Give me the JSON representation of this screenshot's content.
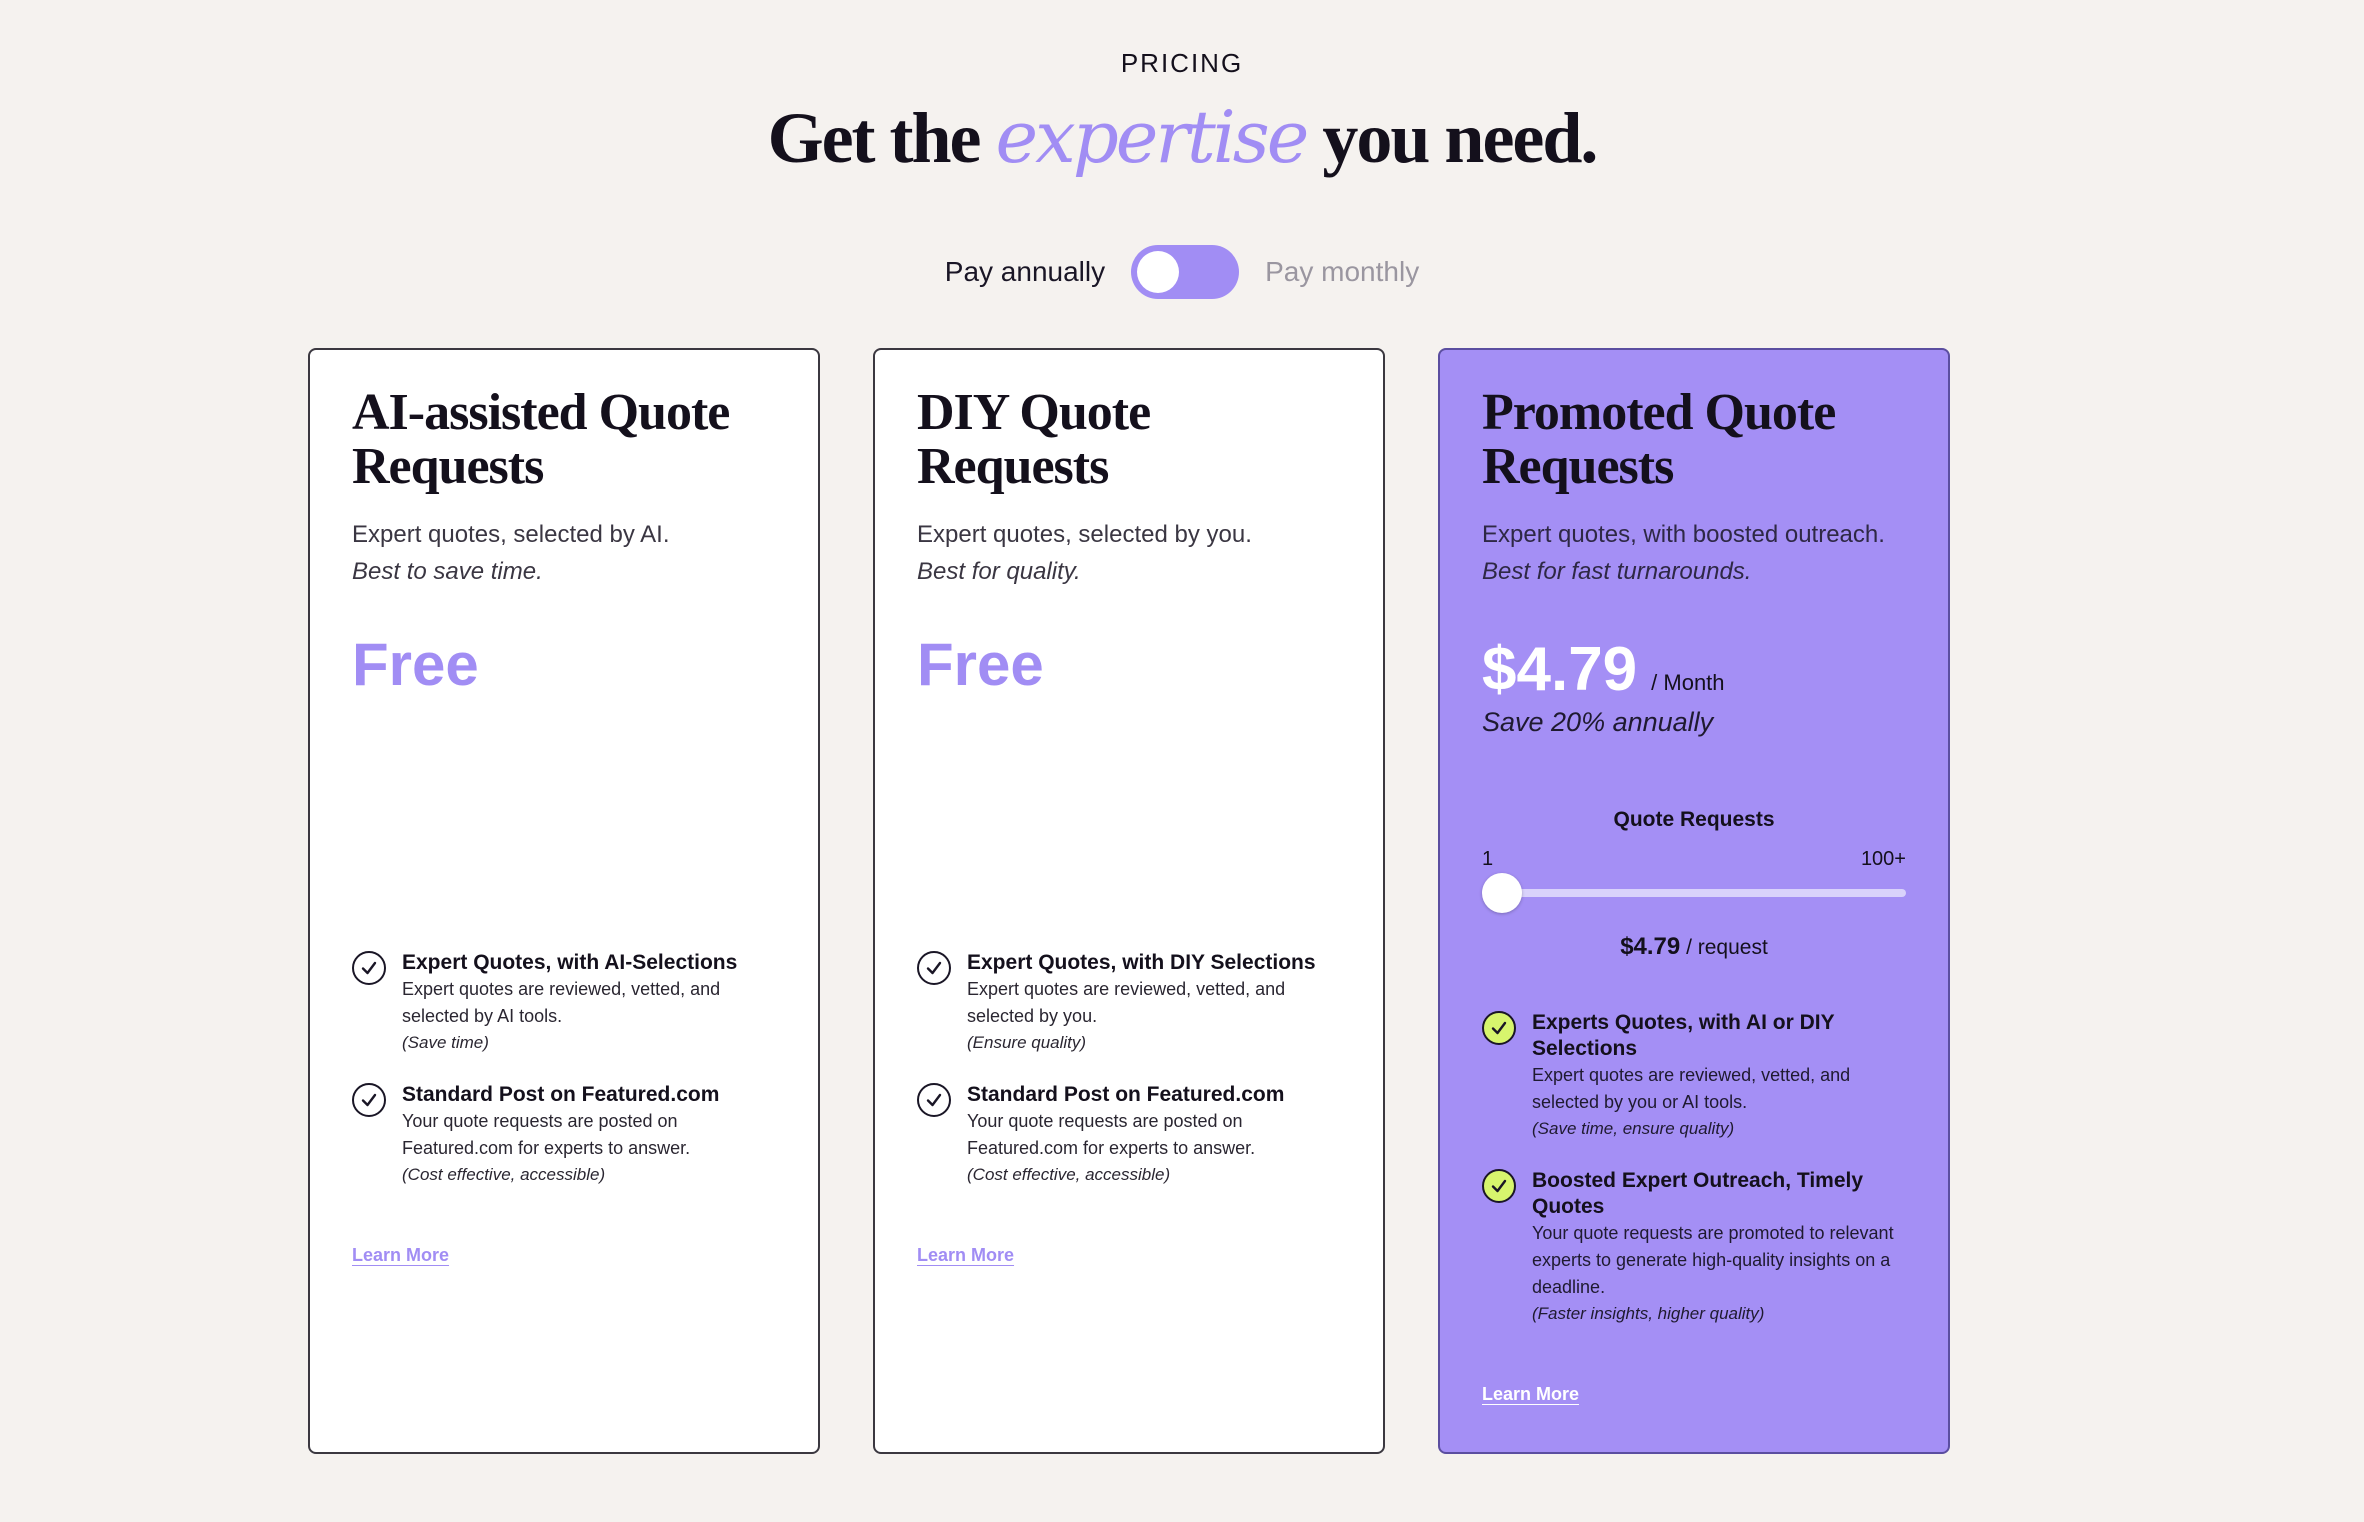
{
  "header": {
    "eyebrow": "PRICING",
    "headline_pre": "Get the",
    "headline_accent": "expertise",
    "headline_post": "you need."
  },
  "billing": {
    "annual_label": "Pay annually",
    "monthly_label": "Pay monthly",
    "selected": "annually"
  },
  "colors": {
    "accent": "#a18df4",
    "promo_card": "#a48ff5",
    "check_lime": "#d7f56d",
    "background": "#f5f2ef"
  },
  "cards": [
    {
      "title": "AI-assisted Quote Requests",
      "subtitle": "Expert quotes, selected by AI.",
      "tagline": "Best to save time.",
      "price": "Free",
      "features": [
        {
          "title": "Expert Quotes, with AI-Selections",
          "desc": "Expert quotes are reviewed, vetted, and selected by AI tools.",
          "note": "(Save time)"
        },
        {
          "title": "Standard Post on Featured.com",
          "desc": "Your quote requests are posted on Featured.com for experts to answer.",
          "note": "(Cost effective, accessible)"
        }
      ],
      "link": "Learn More"
    },
    {
      "title": "DIY Quote Requests",
      "subtitle": "Expert quotes, selected by you.",
      "tagline": "Best for quality.",
      "price": "Free",
      "features": [
        {
          "title": "Expert Quotes, with DIY Selections",
          "desc": "Expert quotes are reviewed, vetted, and selected by you.",
          "note": "(Ensure quality)"
        },
        {
          "title": "Standard Post on Featured.com",
          "desc": "Your quote requests are posted on Featured.com for experts to answer.",
          "note": "(Cost effective, accessible)"
        }
      ],
      "link": "Learn More"
    },
    {
      "title": "Promoted Quote Requests",
      "subtitle": "Expert quotes, with boosted outreach.",
      "tagline": "Best for fast turnarounds.",
      "price": "$4.79",
      "price_unit": "/ Month",
      "save_note": "Save 20% annually",
      "slider": {
        "title": "Quote Requests",
        "min_label": "1",
        "max_label": "100+",
        "value_fraction": 0,
        "per_price": "$4.79",
        "per_unit": "/ request"
      },
      "features": [
        {
          "title": "Experts Quotes, with AI or DIY Selections",
          "desc": "Expert quotes are reviewed, vetted, and selected by you or AI tools.",
          "note": "(Save time, ensure quality)"
        },
        {
          "title": "Boosted Expert Outreach, Timely Quotes",
          "desc": "Your quote requests are promoted to relevant experts to generate high-quality insights on a deadline.",
          "note": "(Faster insights, higher quality)"
        }
      ],
      "link": "Learn More"
    }
  ]
}
